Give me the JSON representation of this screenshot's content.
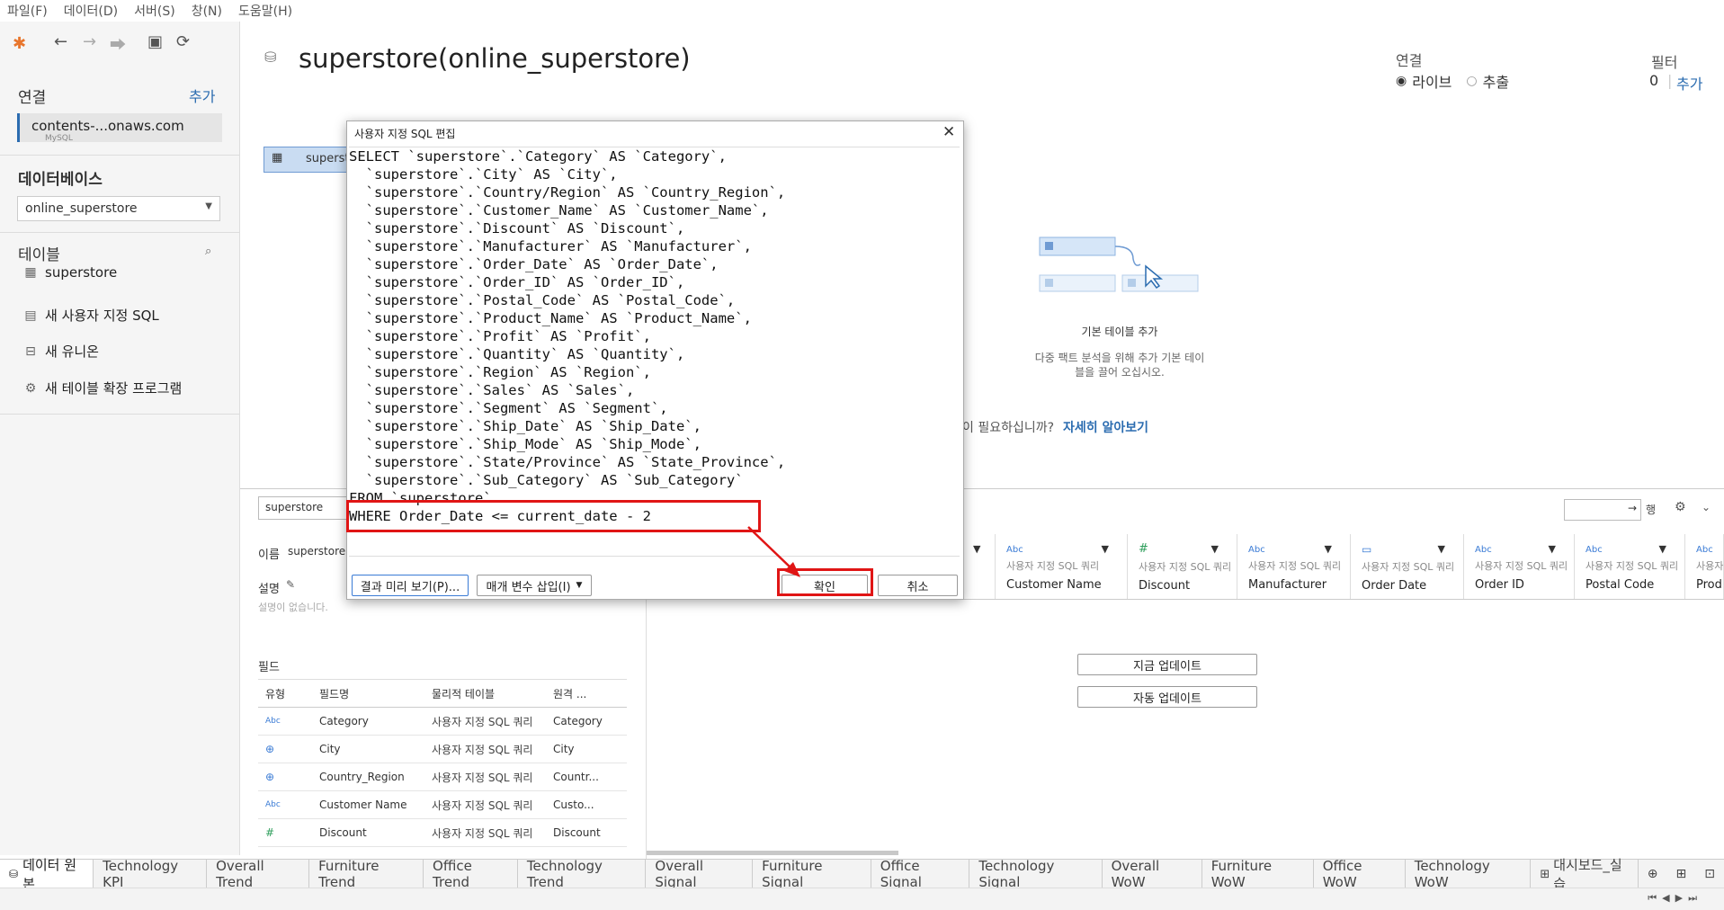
{
  "menu": [
    "파일(F)",
    "데이터(D)",
    "서버(S)",
    "창(N)",
    "도움말(H)"
  ],
  "left": {
    "connection_head": "연결",
    "connection_add": "추가",
    "connection_name": "contents-...onaws.com",
    "connection_type": "MySQL",
    "database_head": "데이터베이스",
    "database_value": "online_superstore",
    "tables_head": "테이블",
    "table_item": "superstore",
    "new_custom_sql": "새 사용자 지정 SQL",
    "new_union": "새 유니온",
    "new_table_ext": "새 테이블 확장 프로그램"
  },
  "main": {
    "datasource_title": "superstore(online_superstore)",
    "canvas_table_chip": "superst",
    "connection_label": "연결",
    "live_label": "라이브",
    "extract_label": "추출",
    "filter_label": "필터",
    "filter_count": "0",
    "filter_add": "추가",
    "base_table_title": "기본 테이블 추가",
    "base_table_desc_1": "다중 팩트 분석을 위해 추가 기본 테이",
    "base_table_desc_2": "블을 끌어 오십시오.",
    "help_text": "이 필요하십니까?",
    "help_link": "자세히 알아보기",
    "rows_label": "행",
    "update_now": "지금 업데이트",
    "auto_update": "자동 업데이트"
  },
  "details": {
    "table_name_box": "superstore",
    "name_label": "이름",
    "name_value": "superstore",
    "desc_label": "설명",
    "desc_empty": "설명이 없습니다.",
    "fields_label": "필드",
    "field_headers": [
      "유형",
      "필드명",
      "물리적 테이블",
      "원격 ..."
    ],
    "field_rows": [
      {
        "type": "Abc",
        "name": "Category",
        "table": "사용자 지정 SQL 쿼리",
        "remote": "Category"
      },
      {
        "type": "globe",
        "name": "City",
        "table": "사용자 지정 SQL 쿼리",
        "remote": "City"
      },
      {
        "type": "globe",
        "name": "Country_Region",
        "table": "사용자 지정 SQL 쿼리",
        "remote": "Countr..."
      },
      {
        "type": "Abc",
        "name": "Customer Name",
        "table": "사용자 지정 SQL 쿼리",
        "remote": "Custo..."
      },
      {
        "type": "#",
        "name": "Discount",
        "table": "사용자 지정 SQL 쿼리",
        "remote": "Discount"
      }
    ]
  },
  "grid_columns": [
    {
      "type": "Abc",
      "source": "사용자 지정 SQL 쿼리",
      "name": "Customer Name"
    },
    {
      "type": "#",
      "source": "사용자 지정 SQL 쿼리",
      "name": "Discount"
    },
    {
      "type": "Abc",
      "source": "사용자 지정 SQL 쿼리",
      "name": "Manufacturer"
    },
    {
      "type": "date",
      "source": "사용자 지정 SQL 쿼리",
      "name": "Order Date"
    },
    {
      "type": "Abc",
      "source": "사용자 지정 SQL 쿼리",
      "name": "Order ID"
    },
    {
      "type": "Abc",
      "source": "사용자 지정 SQL 쿼리",
      "name": "Postal Code"
    },
    {
      "type": "Abc",
      "source": "사용자 지정 SQL",
      "name": "Produ"
    }
  ],
  "modal": {
    "title": "사용자 지정 SQL 편집",
    "sql": "SELECT `superstore`.`Category` AS `Category`,\n  `superstore`.`City` AS `City`,\n  `superstore`.`Country/Region` AS `Country_Region`,\n  `superstore`.`Customer_Name` AS `Customer_Name`,\n  `superstore`.`Discount` AS `Discount`,\n  `superstore`.`Manufacturer` AS `Manufacturer`,\n  `superstore`.`Order_Date` AS `Order_Date`,\n  `superstore`.`Order_ID` AS `Order_ID`,\n  `superstore`.`Postal_Code` AS `Postal_Code`,\n  `superstore`.`Product_Name` AS `Product_Name`,\n  `superstore`.`Profit` AS `Profit`,\n  `superstore`.`Quantity` AS `Quantity`,\n  `superstore`.`Region` AS `Region`,\n  `superstore`.`Sales` AS `Sales`,\n  `superstore`.`Segment` AS `Segment`,\n  `superstore`.`Ship_Date` AS `Ship_Date`,\n  `superstore`.`Ship_Mode` AS `Ship_Mode`,\n  `superstore`.`State/Province` AS `State_Province`,\n  `superstore`.`Sub_Category` AS `Sub_Category`\nFROM `superstore`\nWHERE Order_Date <= current_date - 2",
    "preview_button": "결과 미리 보기(P)...",
    "param_button": "매개 변수 삽입(I)",
    "ok_button": "확인",
    "cancel_button": "취소"
  },
  "tabs": [
    "데이터 원본",
    "Technology KPI",
    "Overall Trend",
    "Furniture Trend",
    "Office Trend",
    "Technology Trend",
    "Overall Signal",
    "Furniture Signal",
    "Office Signal",
    "Technology Signal",
    "Overall WoW",
    "Furniture WoW",
    "Office WoW",
    "Technology WoW",
    "대시보드_실습"
  ],
  "colors": {
    "accent": "#2b6cb0",
    "highlight": "#e01515",
    "chip": "#c9dcf2"
  }
}
